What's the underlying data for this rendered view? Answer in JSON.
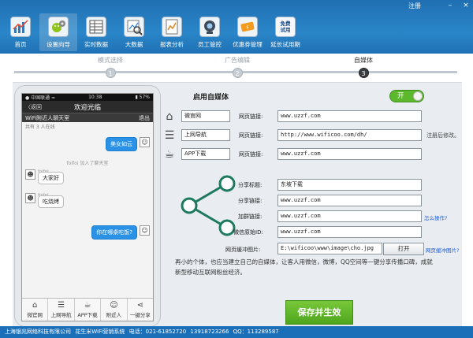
{
  "topbar": {
    "register": "注册",
    "min": "–",
    "close": "×"
  },
  "nav": [
    {
      "label": "首页",
      "icon": "chart-icon"
    },
    {
      "label": "设置向导",
      "icon": "android-gear-icon"
    },
    {
      "label": "实时数据",
      "icon": "table-icon"
    },
    {
      "label": "大数据",
      "icon": "magnifier-chart-icon"
    },
    {
      "label": "报表分析",
      "icon": "report-icon"
    },
    {
      "label": "员工管控",
      "icon": "camera-icon"
    },
    {
      "label": "优惠券管理",
      "icon": "coupon-icon"
    },
    {
      "label": "延长试用期",
      "icon": "free-trial-icon",
      "badge": "免费\n试用"
    }
  ],
  "steps": [
    {
      "label": "模式选择",
      "num": "1"
    },
    {
      "label": "广告编辑",
      "num": "2"
    },
    {
      "label": "自媒体",
      "num": "3"
    }
  ],
  "phone": {
    "status_left": "● 中国联通 ≈",
    "status_time": "10:38",
    "status_right": "▮ 57%",
    "back": "〈返回",
    "title": "欢迎光临",
    "room": "WiFi附近人聊天室",
    "exit": "退出",
    "online": "共有 3 人在线",
    "messages": [
      {
        "text": "美女如云",
        "side": "right"
      },
      {
        "text": "foifoi 加入了聊天室",
        "side": "system"
      },
      {
        "sender": "foifoi",
        "text": "大家好",
        "side": "left"
      },
      {
        "sender": "foifoi",
        "text": "吃烧烤",
        "side": "left"
      },
      {
        "text": "你在哪桌吃饭?",
        "side": "right"
      }
    ],
    "tabs": [
      {
        "label": "微官网",
        "icon": "home-icon",
        "glyph": "⌂"
      },
      {
        "label": "上网导航",
        "icon": "list-icon",
        "glyph": "☰"
      },
      {
        "label": "APP下载",
        "icon": "cup-icon",
        "glyph": "☕"
      },
      {
        "label": "附近人",
        "icon": "person-icon",
        "glyph": "☺"
      },
      {
        "label": "一键分享",
        "icon": "share-icon",
        "glyph": "⋖"
      }
    ]
  },
  "form": {
    "title": "启用自媒体",
    "toggle": "开",
    "rows": [
      {
        "name": "微官网",
        "link_label": "网页链接:",
        "url": "www.uzzf.com"
      },
      {
        "name": "上网导航",
        "link_label": "网页链接:",
        "url": "http://www.wificoo.com/dh/",
        "note": "注册后修改。"
      },
      {
        "name": "APP下载",
        "link_label": "网页链接:",
        "url": "www.uzzf.com"
      }
    ],
    "share": {
      "title_label": "分享标题:",
      "title_value": "东坡下载",
      "link_label": "分享链接:",
      "link_value": "www.uzzf.com",
      "group_label": "加群链接:",
      "group_value": "www.uzzf.com",
      "group_help": "怎么操作?",
      "wechat_label": "微信原始ID:",
      "wechat_value": "www.uzzf.com",
      "img_label": "网页缓冲图片:",
      "img_value": "E:\\wificoo\\www\\image\\cho.jpg",
      "browse": "打开",
      "img_help": "网页缓冲图片?"
    },
    "description": "再小的个体，也应当建立自己的自媒体，让客人用微信，微博，QQ空间等一键分享传播口碑，成就新型移动互联网粉丝经济。",
    "save": "保存并生效"
  },
  "footer": {
    "company": "上海银兆网络科技有限公司",
    "product": "花生米WiFi营销系统",
    "phone": "电话：021-61852720",
    "mobile": "13918723266",
    "qq": "QQ：113289587"
  }
}
